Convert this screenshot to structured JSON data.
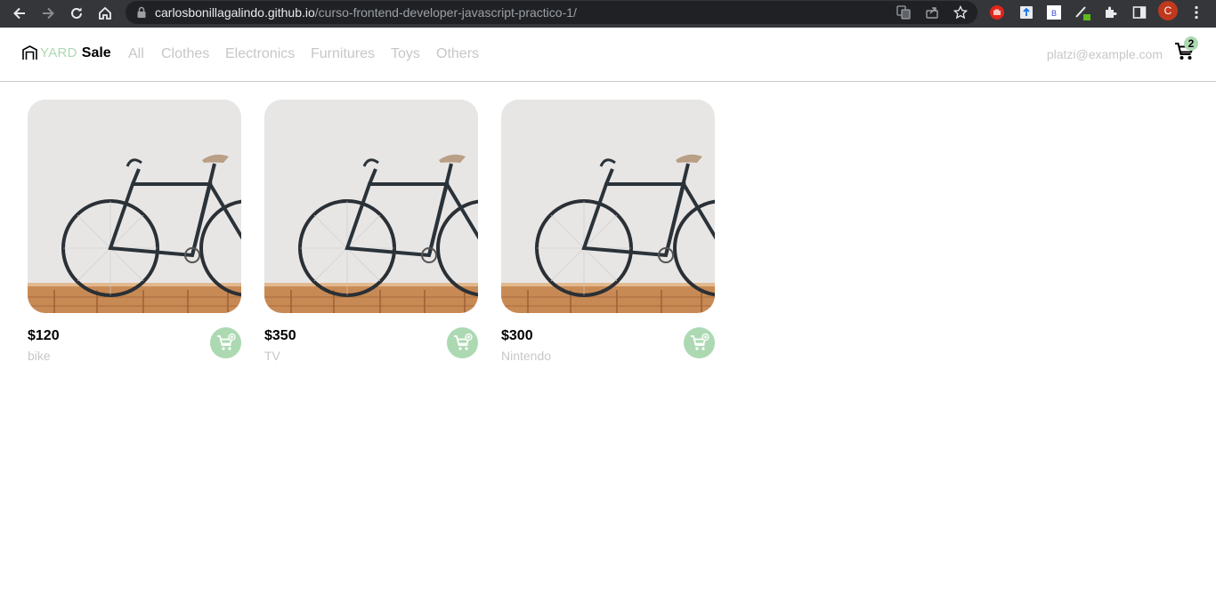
{
  "browser": {
    "url_host": "carlosbonillagalindo.github.io",
    "url_path": "/curso-frontend-developer-javascript-practico-1/",
    "profile_initial": "C"
  },
  "brand": {
    "logo_part1": "YARD",
    "logo_part2": "Sale",
    "accent": "#acd9b2"
  },
  "nav": {
    "links": [
      "All",
      "Clothes",
      "Electronics",
      "Furnitures",
      "Toys",
      "Others"
    ]
  },
  "account": {
    "email": "platzi@example.com",
    "cart_count": "2"
  },
  "products": [
    {
      "price": "$120",
      "name": "bike"
    },
    {
      "price": "$350",
      "name": "TV"
    },
    {
      "price": "$300",
      "name": "Nintendo"
    }
  ]
}
